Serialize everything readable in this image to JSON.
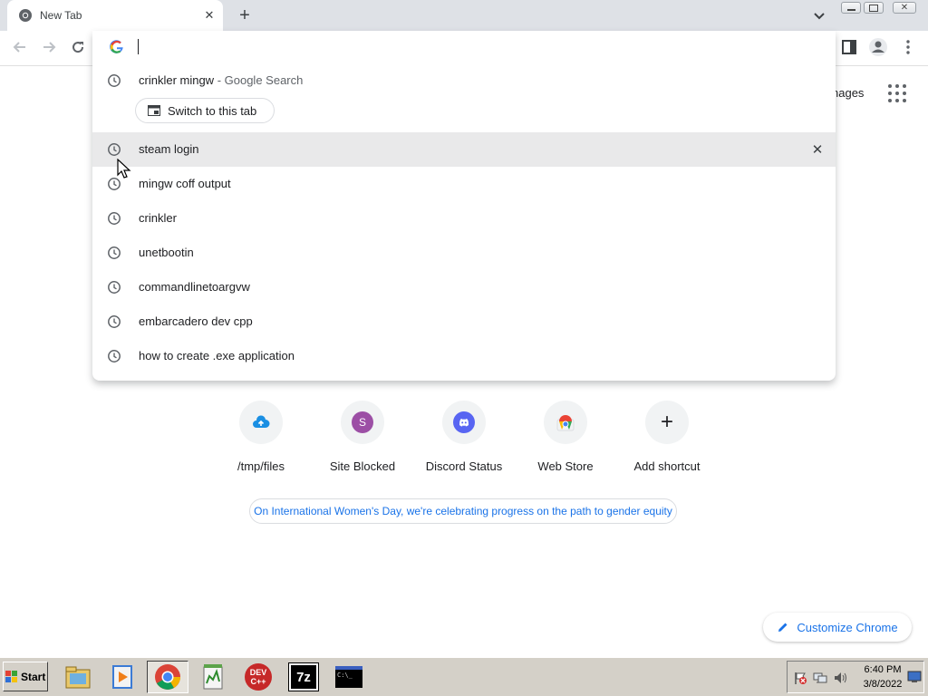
{
  "tab": {
    "title": "New Tab",
    "new_tab_symbol": "+"
  },
  "toolbar": {
    "icons": [
      "back-arrow-icon",
      "forward-arrow-icon",
      "reload-icon",
      "side-panel-icon",
      "profile-icon",
      "menu-icon"
    ]
  },
  "omnibox": {
    "input_value": "",
    "suggestions": [
      {
        "text": "crinkler mingw",
        "suffix": " - Google Search",
        "icon": "history-clock-icon"
      },
      {
        "text": "steam login",
        "icon": "history-clock-icon",
        "highlighted": true
      },
      {
        "text": "mingw coff output",
        "icon": "history-clock-icon"
      },
      {
        "text": "crinkler",
        "icon": "history-clock-icon"
      },
      {
        "text": "unetbootin",
        "icon": "history-clock-icon"
      },
      {
        "text": "commandlinetoargvw",
        "icon": "history-clock-icon"
      },
      {
        "text": "embarcadero dev cpp",
        "icon": "history-clock-icon"
      },
      {
        "text": "how to create .exe application",
        "icon": "history-clock-icon"
      }
    ],
    "switch_tab_label": "Switch to this tab",
    "remove_symbol": "✕"
  },
  "ntp": {
    "images_link": "nages",
    "shortcuts": [
      {
        "label": "/tmp/files",
        "icon": "cloud-upload-icon"
      },
      {
        "label": "Site Blocked",
        "icon": "letter-avatar-icon",
        "letter": "S"
      },
      {
        "label": "Discord Status",
        "icon": "discord-icon"
      },
      {
        "label": "Web Store",
        "icon": "web-store-icon"
      },
      {
        "label": "Add shortcut",
        "icon": "plus-icon",
        "symbol": "+"
      }
    ],
    "promo": "On International Women's Day, we're celebrating progress on the path to gender equity",
    "customize": "Customize Chrome"
  },
  "taskbar": {
    "start_label": "Start",
    "apps": [
      "file-manager-icon",
      "media-player-icon",
      "chrome-icon",
      "notepad-icon",
      "dev-cpp-icon",
      "7zip-icon",
      "command-prompt-icon"
    ],
    "devcpp_text": "DEV C++",
    "sevenzip_text": "7z",
    "cmd_text": "C:\\_",
    "clock_time": "6:40 PM",
    "clock_date": "3/8/2022"
  },
  "colors": {
    "accent": "#1a73e8",
    "tabstrip": "#dee1e6",
    "highlight_row": "#e9e9ea",
    "taskbar": "#d4d0c8"
  }
}
